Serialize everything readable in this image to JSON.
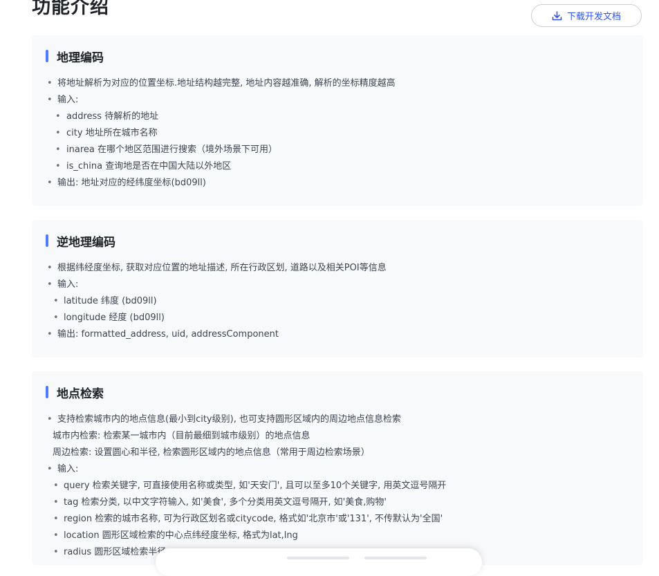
{
  "header": {
    "title": "功能介绍",
    "download_label": "下载开发文档"
  },
  "cards": [
    {
      "title": "地理编码",
      "lines": [
        {
          "text": "将地址解析为对应的位置坐标.地址结构越完整, 地址内容越准确, 解析的坐标精度越高"
        },
        {
          "text": "输入:"
        },
        {
          "text": "address 待解析的地址"
        },
        {
          "text": "city 地址所在城市名称"
        },
        {
          "text": "inarea 在哪个地区范围进行搜索（境外场景下可用）"
        },
        {
          "text": "is_china 查询地是否在中国大陆以外地区"
        },
        {
          "text": "输出: 地址对应的经纬度坐标(bd09ll)"
        }
      ]
    },
    {
      "title": "逆地理编码",
      "lines": [
        {
          "text": "根据纬经度坐标, 获取对应位置的地址描述, 所在行政区划, 道路以及相关POI等信息"
        },
        {
          "text": "输入:"
        },
        {
          "text": "latitude 纬度 (bd09ll)"
        },
        {
          "text": "longitude 经度 (bd09ll)"
        },
        {
          "text": "输出: formatted_address, uid, addressComponent"
        }
      ]
    },
    {
      "title": "地点检索",
      "lines": [
        {
          "text": "支持检索城市内的地点信息(最小到city级别), 也可支持圆形区域内的周边地点信息检索"
        },
        {
          "text": "城市内检索: 检索某一城市内（目前最细到城市级别）的地点信息"
        },
        {
          "text": "周边检索: 设置圆心和半径, 检索圆形区域内的地点信息（常用于周边检索场景）"
        },
        {
          "text": "输入:"
        },
        {
          "text": "query 检索关键字, 可直接使用名称或类型, 如'天安门', 且可以至多10个关键字, 用英文逗号隔开"
        },
        {
          "text": "tag 检索分类, 以中文字符输入, 如'美食', 多个分类用英文逗号隔开, 如'美食,购物'"
        },
        {
          "text": "region 检索的城市名称, 可为行政区划名或citycode, 格式如'北京市'或'131', 不传默认为'全国'"
        },
        {
          "text": "location 圆形区域检索的中心点纬经度坐标, 格式为lat,lng"
        },
        {
          "text": "radius 圆形区域检索半径"
        }
      ]
    }
  ],
  "colors": {
    "accent": "#4e7bff",
    "link": "#2f54eb",
    "card_bg": "#f8f9fb"
  },
  "icons": {
    "download": "download-icon",
    "bullet": "•"
  }
}
